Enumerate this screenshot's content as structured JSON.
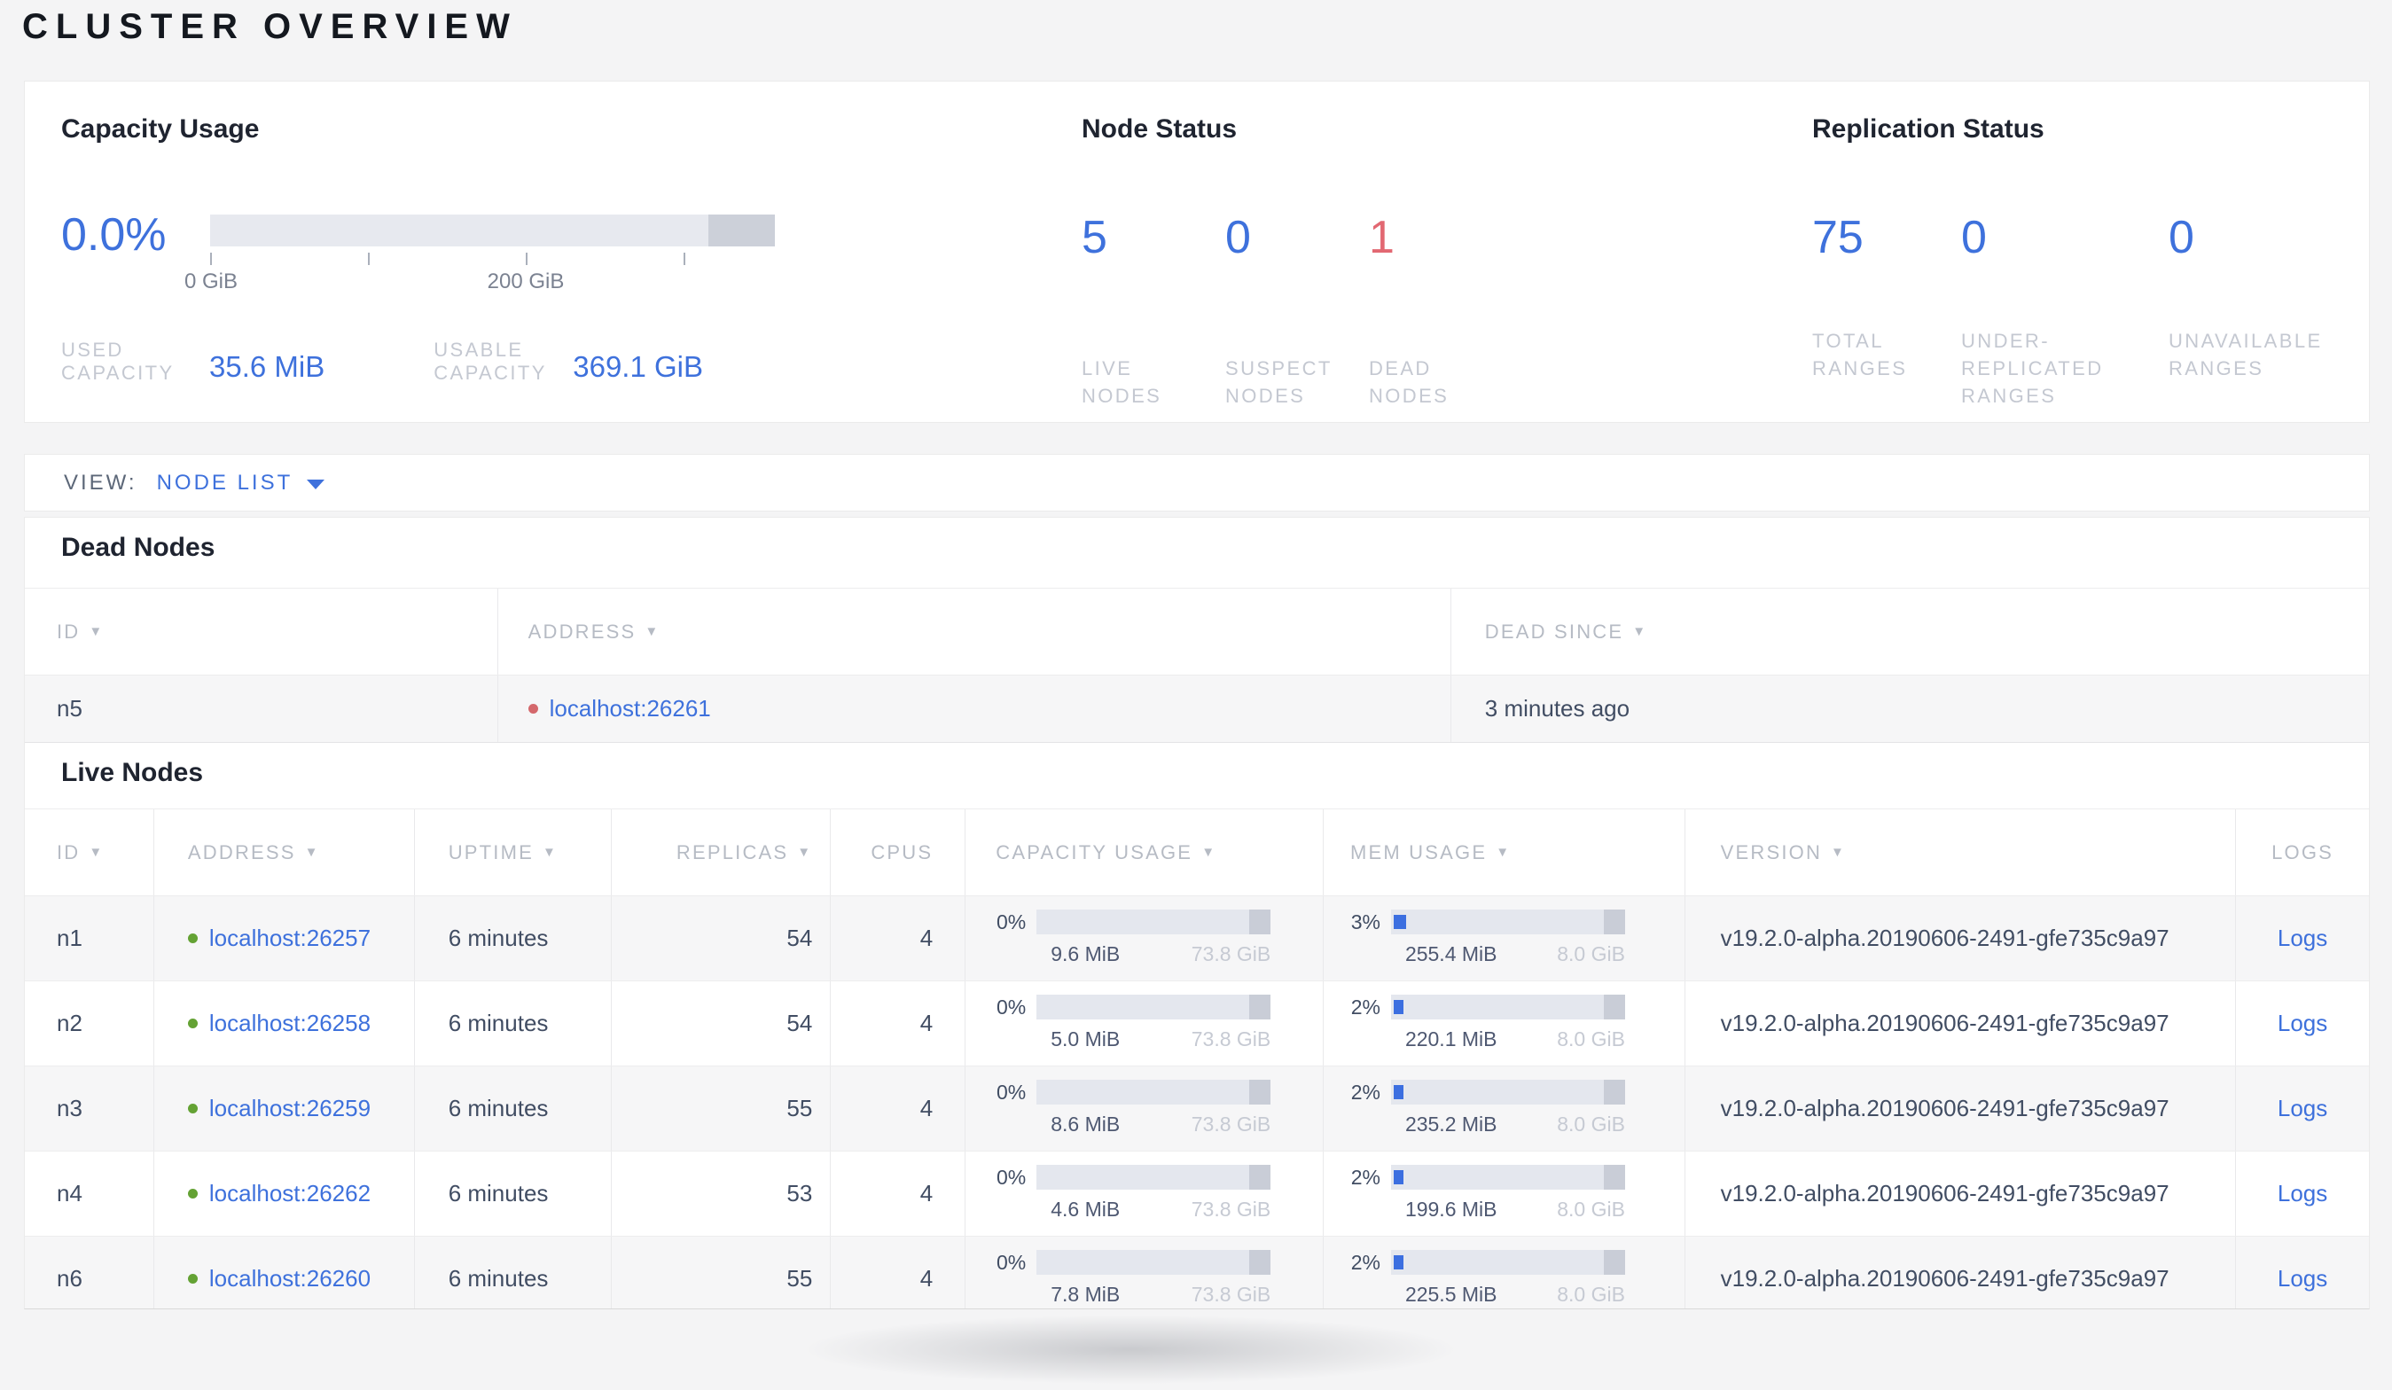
{
  "page": {
    "title": "CLUSTER OVERVIEW"
  },
  "summary": {
    "capacity": {
      "heading": "Capacity Usage",
      "percent": "0.0%",
      "axis_labels": [
        "0 GiB",
        "200 GiB"
      ],
      "used": {
        "label": "USED\nCAPACITY",
        "value": "35.6 MiB"
      },
      "usable": {
        "label": "USABLE\nCAPACITY",
        "value": "369.1 GiB"
      }
    },
    "node_status": {
      "heading": "Node Status",
      "stats": [
        {
          "value": "5",
          "label": "LIVE\nNODES",
          "status": "live"
        },
        {
          "value": "0",
          "label": "SUSPECT\nNODES",
          "status": "suspect"
        },
        {
          "value": "1",
          "label": "DEAD\nNODES",
          "status": "dead"
        }
      ]
    },
    "replication": {
      "heading": "Replication Status",
      "stats": [
        {
          "value": "75",
          "label": "TOTAL\nRANGES"
        },
        {
          "value": "0",
          "label": "UNDER-\nREPLICATED\nRANGES"
        },
        {
          "value": "0",
          "label": "UNAVAILABLE\nRANGES"
        }
      ]
    }
  },
  "view_bar": {
    "label": "VIEW:",
    "selected": "NODE LIST"
  },
  "dead_nodes": {
    "heading": "Dead Nodes",
    "columns": [
      {
        "label": "ID",
        "sortable": true
      },
      {
        "label": "ADDRESS",
        "sortable": true
      },
      {
        "label": "DEAD SINCE",
        "sortable": true
      }
    ],
    "rows": [
      {
        "id": "n5",
        "address": "localhost:26261",
        "dead_since": "3 minutes ago"
      }
    ]
  },
  "live_nodes": {
    "heading": "Live Nodes",
    "columns": [
      {
        "label": "ID",
        "sortable": true
      },
      {
        "label": "ADDRESS",
        "sortable": true
      },
      {
        "label": "UPTIME",
        "sortable": true
      },
      {
        "label": "REPLICAS",
        "sortable": true
      },
      {
        "label": "CPUS",
        "sortable": false
      },
      {
        "label": "CAPACITY USAGE",
        "sortable": true
      },
      {
        "label": "MEM USAGE",
        "sortable": true
      },
      {
        "label": "VERSION",
        "sortable": true
      },
      {
        "label": "LOGS",
        "sortable": false
      }
    ],
    "rows": [
      {
        "id": "n1",
        "address": "localhost:26257",
        "uptime": "6 minutes",
        "replicas": "54",
        "cpus": "4",
        "capacity": {
          "percent": "0%",
          "used": "9.6 MiB",
          "total": "73.8 GiB",
          "fill_pct": 0
        },
        "memory": {
          "percent": "3%",
          "used": "255.4 MiB",
          "total": "8.0 GiB",
          "fill_pct": 3
        },
        "version": "v19.2.0-alpha.20190606-2491-gfe735c9a97",
        "logs_label": "Logs"
      },
      {
        "id": "n2",
        "address": "localhost:26258",
        "uptime": "6 minutes",
        "replicas": "54",
        "cpus": "4",
        "capacity": {
          "percent": "0%",
          "used": "5.0 MiB",
          "total": "73.8 GiB",
          "fill_pct": 0
        },
        "memory": {
          "percent": "2%",
          "used": "220.1 MiB",
          "total": "8.0 GiB",
          "fill_pct": 2
        },
        "version": "v19.2.0-alpha.20190606-2491-gfe735c9a97",
        "logs_label": "Logs"
      },
      {
        "id": "n3",
        "address": "localhost:26259",
        "uptime": "6 minutes",
        "replicas": "55",
        "cpus": "4",
        "capacity": {
          "percent": "0%",
          "used": "8.6 MiB",
          "total": "73.8 GiB",
          "fill_pct": 0
        },
        "memory": {
          "percent": "2%",
          "used": "235.2 MiB",
          "total": "8.0 GiB",
          "fill_pct": 2
        },
        "version": "v19.2.0-alpha.20190606-2491-gfe735c9a97",
        "logs_label": "Logs"
      },
      {
        "id": "n4",
        "address": "localhost:26262",
        "uptime": "6 minutes",
        "replicas": "53",
        "cpus": "4",
        "capacity": {
          "percent": "0%",
          "used": "4.6 MiB",
          "total": "73.8 GiB",
          "fill_pct": 0
        },
        "memory": {
          "percent": "2%",
          "used": "199.6 MiB",
          "total": "8.0 GiB",
          "fill_pct": 2
        },
        "version": "v19.2.0-alpha.20190606-2491-gfe735c9a97",
        "logs_label": "Logs"
      },
      {
        "id": "n6",
        "address": "localhost:26260",
        "uptime": "6 minutes",
        "replicas": "55",
        "cpus": "4",
        "capacity": {
          "percent": "0%",
          "used": "7.8 MiB",
          "total": "73.8 GiB",
          "fill_pct": 0
        },
        "memory": {
          "percent": "2%",
          "used": "225.5 MiB",
          "total": "8.0 GiB",
          "fill_pct": 2
        },
        "version": "v19.2.0-alpha.20190606-2491-gfe735c9a97",
        "logs_label": "Logs"
      }
    ]
  },
  "colors": {
    "accent_blue": "#3e71dc",
    "dead_red": "#e26872",
    "live_green": "#64a234"
  }
}
